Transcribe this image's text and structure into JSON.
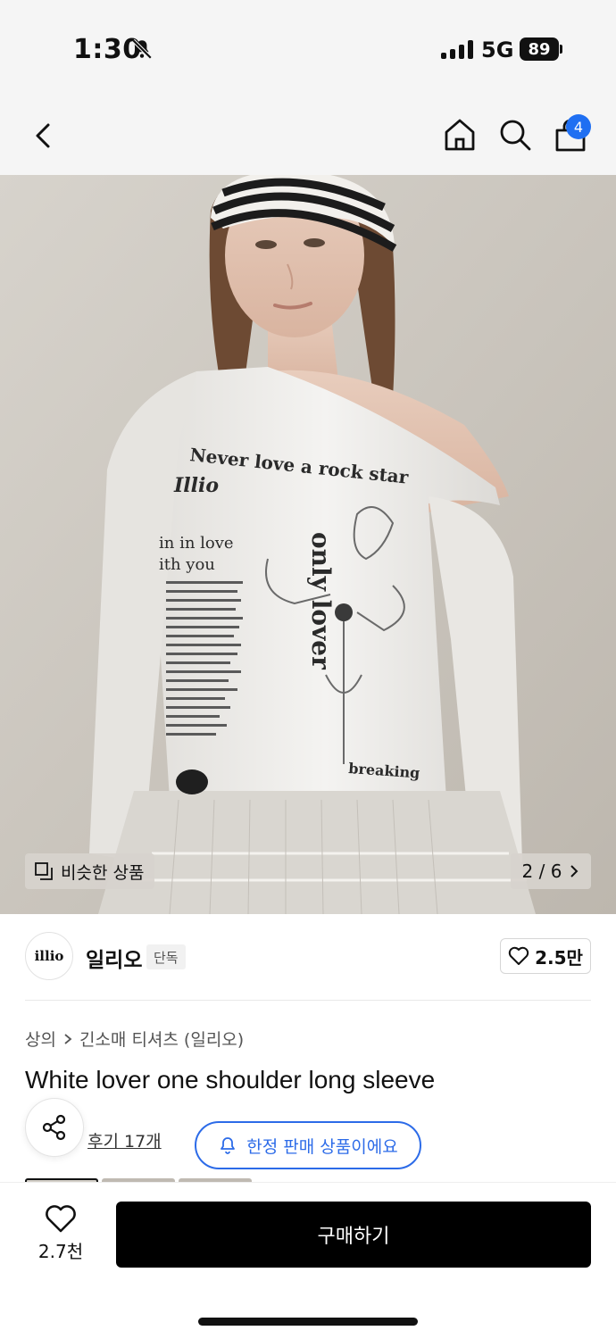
{
  "status_bar": {
    "time": "1:30",
    "network": "5G",
    "battery": "89"
  },
  "nav": {
    "cart_count": "4"
  },
  "gallery": {
    "similar_label": "비슷한 상품",
    "page_indicator": "2 / 6",
    "print_lines": [
      "Never love a rock star",
      "Illio",
      "in in love",
      "ith you",
      "only lover",
      "breaking"
    ]
  },
  "brand": {
    "logo_text": "illio",
    "name": "일리오",
    "tag": "단독",
    "likes": "2.5만"
  },
  "breadcrumb": {
    "category": "상의",
    "subcategory": "긴소매 티셔츠 (일리오)"
  },
  "product": {
    "title": "White lover one shoulder long sleeve",
    "reviews": "후기 17개",
    "limited_notice": "한정 판매 상품이에요"
  },
  "bottom_bar": {
    "wish_count": "2.7천",
    "buy_label": "구매하기"
  },
  "icons": [
    "bell-slash-icon",
    "back-icon",
    "home-icon",
    "search-icon",
    "bag-icon",
    "similar-icon",
    "chevron-right-icon",
    "heart-icon",
    "share-icon",
    "bell-icon"
  ],
  "colors": {
    "accent": "#2c6be8",
    "badge": "#1f6ff2",
    "buy_button": "#000000"
  }
}
